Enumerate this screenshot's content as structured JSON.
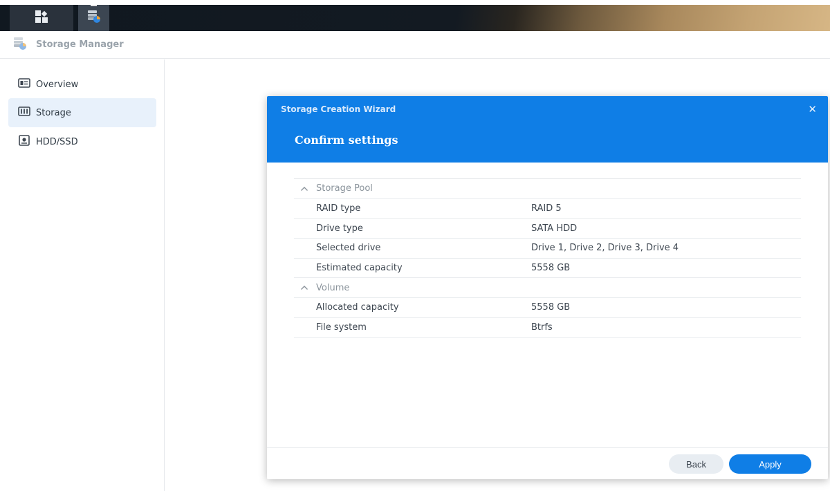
{
  "taskbar": {
    "main_menu_icon": "grid-icon",
    "storage_app_icon": "storage-manager-icon"
  },
  "window": {
    "title": "Storage Manager",
    "icon": "storage-manager-icon"
  },
  "sidebar": {
    "items": [
      {
        "label": "Overview",
        "icon": "overview-icon",
        "active": false
      },
      {
        "label": "Storage",
        "icon": "storage-icon",
        "active": true
      },
      {
        "label": "HDD/SSD",
        "icon": "hdd-icon",
        "active": false
      }
    ]
  },
  "dialog": {
    "title": "Storage Creation Wizard",
    "step_title": "Confirm settings",
    "close_icon": "close-icon",
    "groups": [
      {
        "label": "Storage Pool",
        "rows": [
          {
            "key": "RAID type",
            "value": "RAID 5"
          },
          {
            "key": "Drive type",
            "value": "SATA HDD"
          },
          {
            "key": "Selected drive",
            "value": "Drive 1, Drive 2, Drive 3, Drive 4"
          },
          {
            "key": "Estimated capacity",
            "value": "5558 GB"
          }
        ]
      },
      {
        "label": "Volume",
        "rows": [
          {
            "key": "Allocated capacity",
            "value": "5558 GB"
          },
          {
            "key": "File system",
            "value": "Btrfs"
          }
        ]
      }
    ],
    "buttons": {
      "back": "Back",
      "apply": "Apply"
    }
  },
  "colors": {
    "accent": "#0f7ee6",
    "sidebar_active": "#e8f1fb"
  }
}
